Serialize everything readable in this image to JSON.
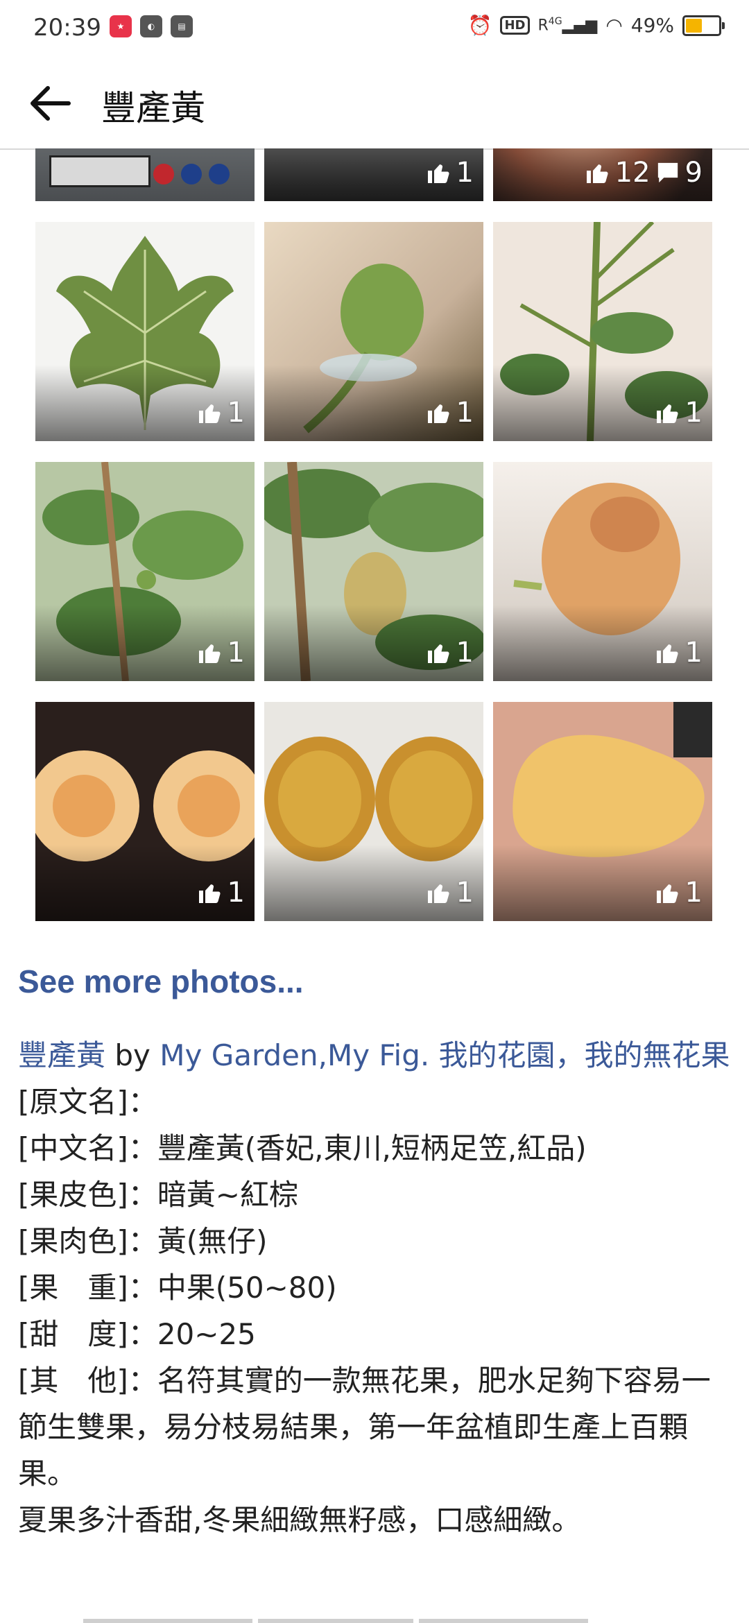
{
  "status_bar": {
    "time": "20:39",
    "network": "4G",
    "battery_percent_label": "49%",
    "battery_level": 0.49
  },
  "app_bar": {
    "title": "豐產黃",
    "back_icon": "arrow-left-icon"
  },
  "photos": [
    {
      "likes": "",
      "comments": ""
    },
    {
      "likes": "1",
      "comments": ""
    },
    {
      "likes": "12",
      "comments": "9"
    },
    {
      "likes": "1",
      "comments": ""
    },
    {
      "likes": "1",
      "comments": ""
    },
    {
      "likes": "1",
      "comments": ""
    },
    {
      "likes": "1",
      "comments": ""
    },
    {
      "likes": "1",
      "comments": ""
    },
    {
      "likes": "1",
      "comments": ""
    },
    {
      "likes": "1",
      "comments": ""
    },
    {
      "likes": "1",
      "comments": ""
    },
    {
      "likes": "1",
      "comments": ""
    }
  ],
  "see_more": "See more photos...",
  "post": {
    "name": "豐產黃",
    "by": "by",
    "author": "My Garden,My Fig. 我的花園，我的無花果",
    "lines": [
      "[原文名]：",
      "[中文名]：豐產黃(香妃,東川,短柄足笠,紅品)",
      "[果皮色]：暗黃~紅棕",
      "[果肉色]：黃(無仔)",
      "[果　重]：中果(50~80)",
      "[甜　度]：20~25"
    ],
    "other": "[其　他]：名符其實的一款無花果，肥水足夠下容易一節生雙果，易分枝易結果，第一年盆植即生產上百顆果。",
    "last": "夏果多汁香甜,冬果細緻無籽感，口感細緻。"
  }
}
